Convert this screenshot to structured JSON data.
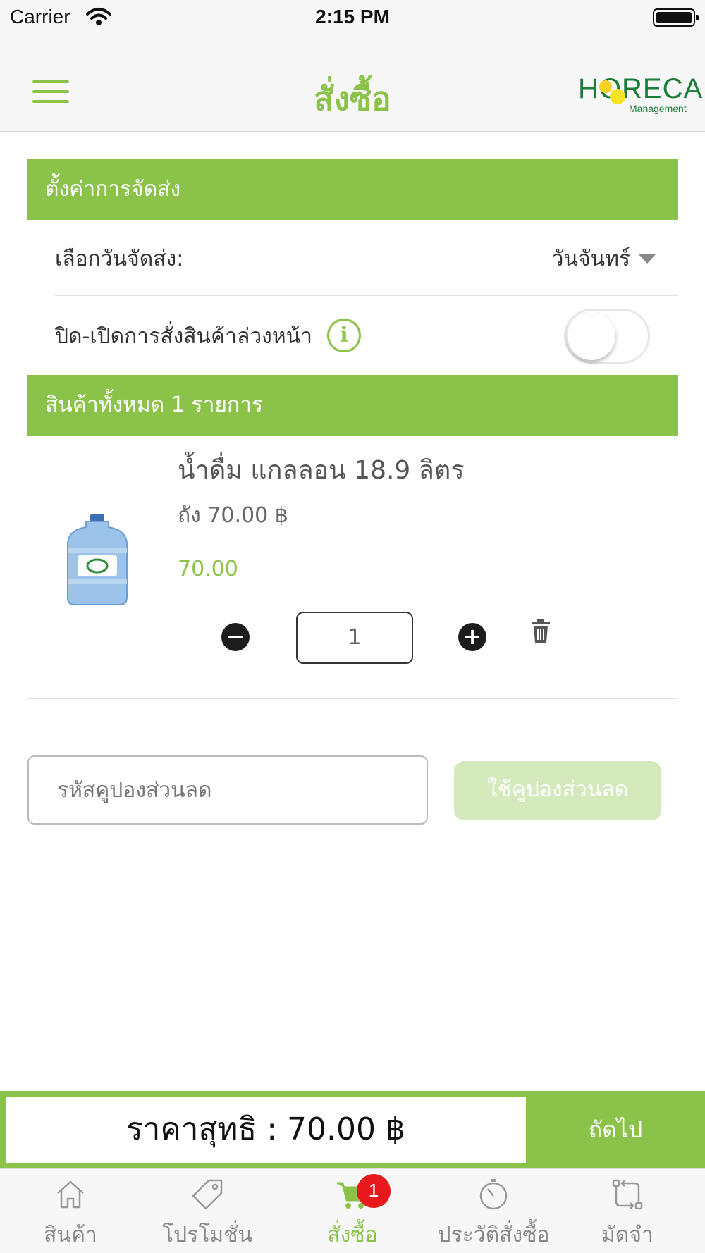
{
  "status_bar": {
    "carrier": "Carrier",
    "time": "2:15 PM"
  },
  "nav": {
    "title": "สั่งซื้อ",
    "logo_text": "HORECA",
    "logo_subtext": "Management"
  },
  "delivery_settings": {
    "header": "ตั้งค่าการจัดส่ง",
    "day_label": "เลือกวันจัดส่ง:",
    "day_value": "วันจันทร์",
    "preorder_label": "ปิด-เปิดการสั่งสินค้าล่วงหน้า",
    "info_glyph": "i",
    "preorder_enabled": false
  },
  "items_section": {
    "header_prefix": "สินค้าทั้งหมด",
    "count": "1",
    "header_suffix": "รายการ"
  },
  "product": {
    "name": "น้ำดื่ม แกลลอน 18.9 ลิตร",
    "unit_price": "ถัง 70.00 ฿",
    "price": "70.00",
    "quantity": "1",
    "minus": "−",
    "plus": "+",
    "image": "water-gallon"
  },
  "coupon": {
    "placeholder": "รหัสคูปองส่วนลด",
    "button_label": "ใช้คูปองส่วนลด"
  },
  "total": {
    "label": "ราคาสุทธิ : 70.00 ฿",
    "next_label": "ถัดไป"
  },
  "tabs": [
    {
      "label": "สินค้า",
      "icon": "home-icon",
      "active": false
    },
    {
      "label": "โปรโมชั่น",
      "icon": "tag-icon",
      "active": false
    },
    {
      "label": "สั่งซื้อ",
      "icon": "cart-icon",
      "active": true
    },
    {
      "label": "ประวัติสั่งซื้อ",
      "icon": "history-icon",
      "active": false
    },
    {
      "label": "มัดจำ",
      "icon": "exchange-icon",
      "active": false
    }
  ],
  "cart_badge": "1",
  "colors": {
    "accent": "#8bc34a",
    "badge": "#e8191d",
    "coupon_button": "#d4e9bc"
  }
}
